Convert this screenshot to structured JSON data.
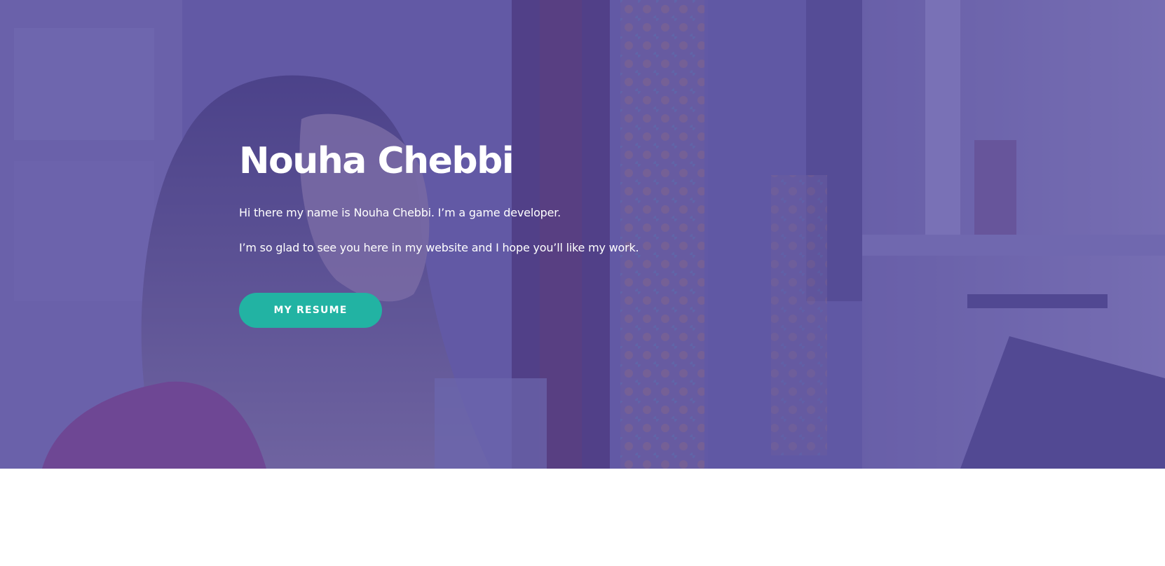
{
  "hero": {
    "title": "Nouha Chebbi",
    "intro": "Hi there my name is Nouha Chebbi. I’m a game developer.",
    "welcome": "I’m so glad to see you here in my website and I hope you’ll like my work.",
    "button_label": "MY RESUME",
    "background_image": "portrait-photo-background",
    "colors": {
      "overlay": "#5d549e",
      "button": "#22b3a3",
      "text": "#ffffff",
      "page": "#ffffff"
    }
  }
}
